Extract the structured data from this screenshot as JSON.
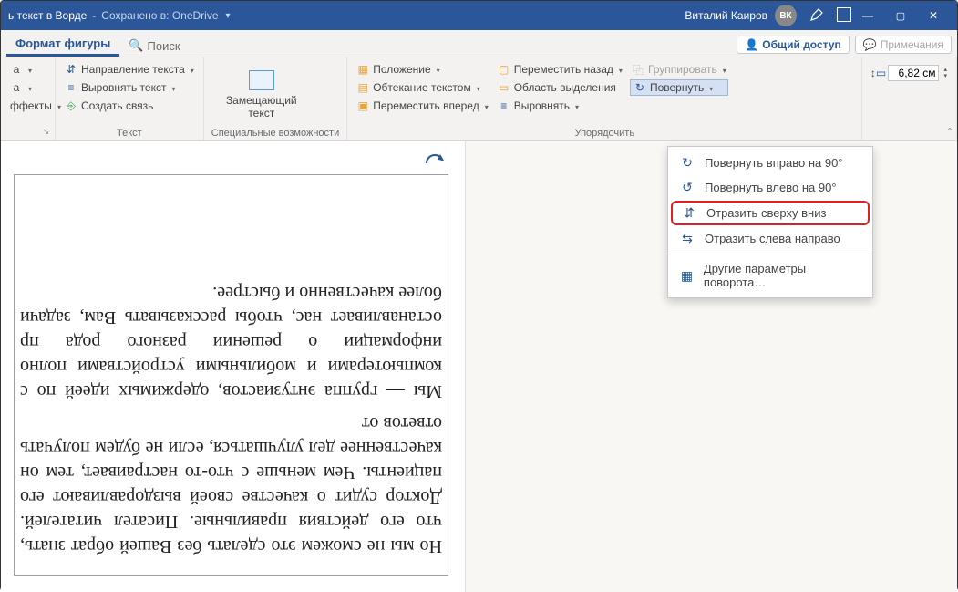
{
  "titlebar": {
    "doc_title_fragment": "ь текст в Ворде",
    "saved_label": "Сохранено в: OneDrive",
    "user_name": "Виталий Каиров",
    "user_initials": "ВК"
  },
  "tabs": {
    "active": "Формат фигуры",
    "search_label": "Поиск",
    "share_label": "Общий доступ",
    "comments_label": "Примечания"
  },
  "ribbon": {
    "styles": {
      "effects": "ффекты"
    },
    "text": {
      "group_label": "Текст",
      "direction": "Направление текста",
      "align": "Выровнять текст",
      "create_link": "Создать связь"
    },
    "accessibility": {
      "group_label": "Специальные возможности",
      "alt_text": "Замещающий текст"
    },
    "arrange": {
      "group_label": "Упорядочить",
      "position": "Положение",
      "wrap": "Обтекание текстом",
      "bring_forward": "Переместить вперед",
      "send_backward": "Переместить назад",
      "selection_pane": "Область выделения",
      "align_objects": "Выровнять",
      "group": "Группировать",
      "rotate": "Повернуть"
    },
    "size": {
      "height": "6,82 см"
    }
  },
  "rotate_menu": {
    "right90": "Повернуть вправо на 90°",
    "left90": "Повернуть влево на 90°",
    "flip_v": "Отразить сверху вниз",
    "flip_h": "Отразить слева направо",
    "more": "Другие параметры поворота…"
  },
  "document": {
    "para1": "Мы — группа энтузиастов, одержимых идеей по с компьютерами и мобильными устройствами полно информации о решении разного рода пр останавливает нас, чтобы рассказывать Вам, задачи более качественно и быстрее.",
    "para2": "Но мы не сможем это сделать без Вашей обрат знать, что его действия правильные. Писател читателей. Доктор судит о качестве своей выздоравливают его пациенты. Чем меньше с что-то настраивает, тем он качественнее дел улучшаться, если не будем получать ответов от"
  }
}
